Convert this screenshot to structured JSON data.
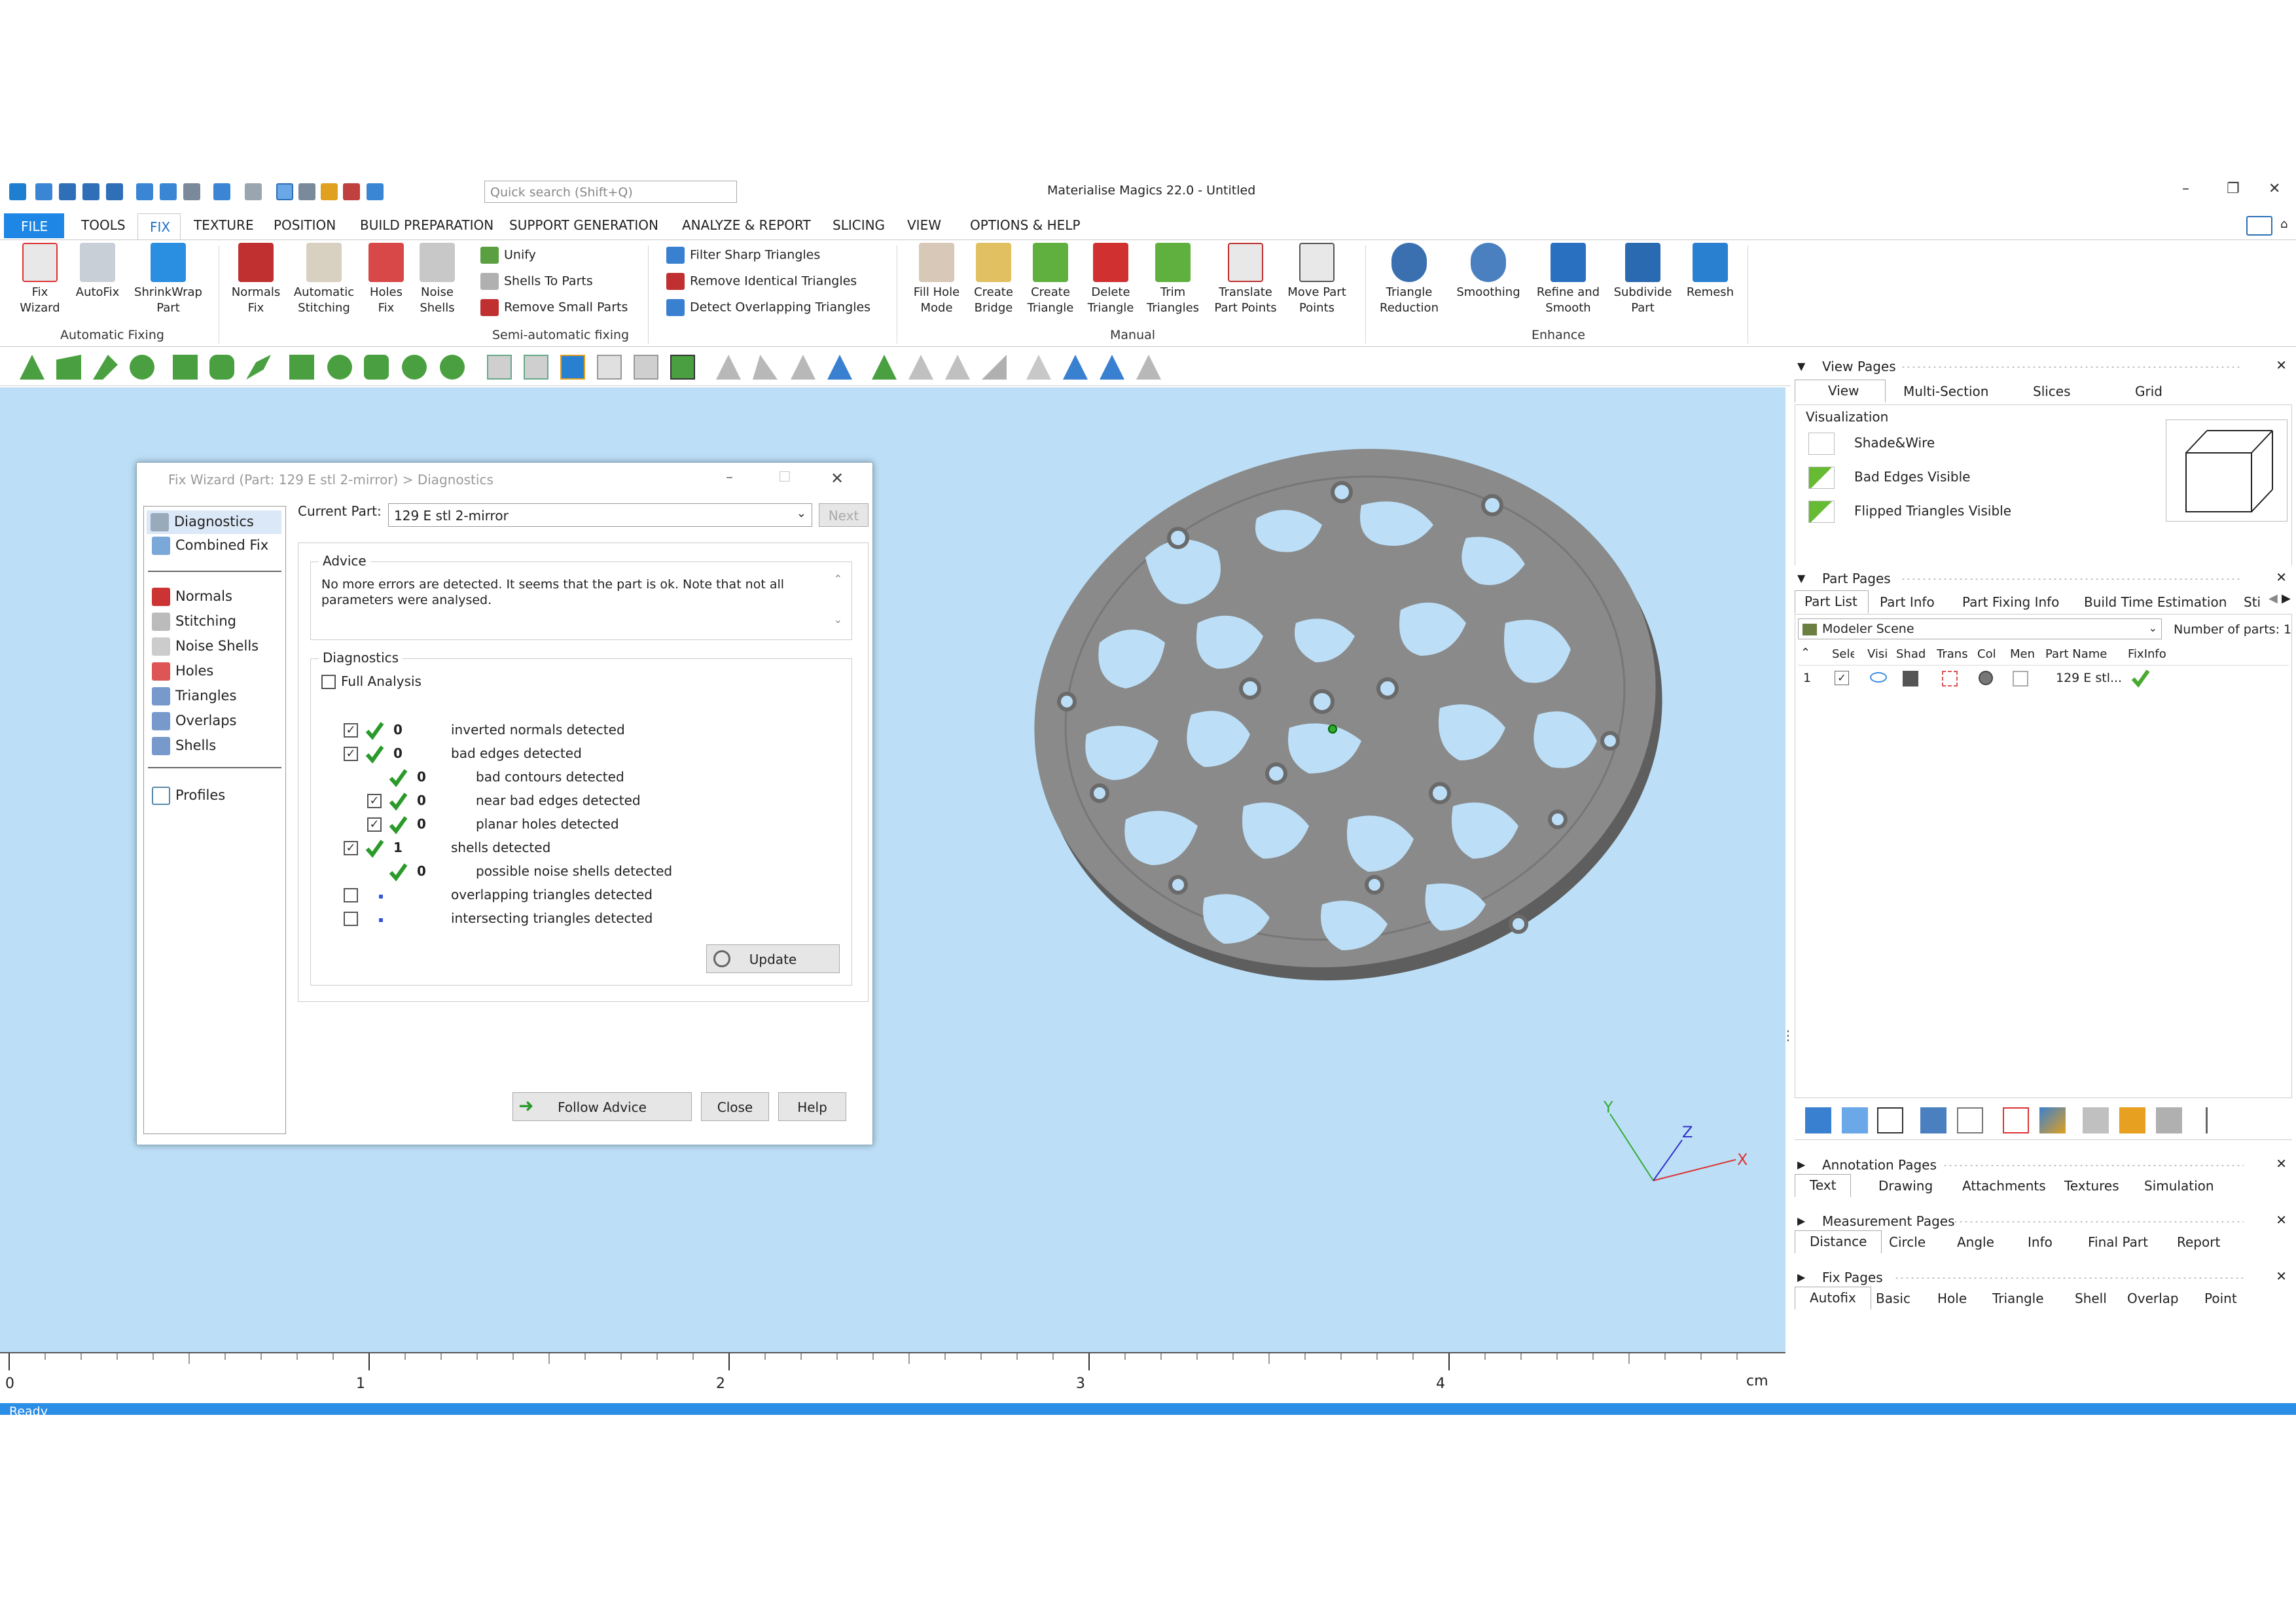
{
  "window": {
    "title": "Materialise Magics 22.0 - Untitled",
    "search_placeholder": "Quick search (Shift+Q)"
  },
  "tabs": [
    "FILE",
    "TOOLS",
    "FIX",
    "TEXTURE",
    "POSITION",
    "BUILD PREPARATION",
    "SUPPORT GENERATION",
    "ANALYZE & REPORT",
    "SLICING",
    "VIEW",
    "OPTIONS & HELP"
  ],
  "ribbon": {
    "auto": [
      {
        "l1": "Fix",
        "l2": "Wizard"
      },
      {
        "l1": "AutoFix",
        "l2": ""
      },
      {
        "l1": "ShrinkWrap",
        "l2": "Part"
      }
    ],
    "auto_group": "Automatic Fixing",
    "semi": [
      {
        "l1": "Normals",
        "l2": "Fix"
      },
      {
        "l1": "Automatic",
        "l2": "Stitching"
      },
      {
        "l1": "Holes",
        "l2": "Fix"
      },
      {
        "l1": "Noise",
        "l2": "Shells"
      }
    ],
    "semi_small": [
      "Unify",
      "Shells To Parts",
      "Remove Small Parts"
    ],
    "semi_group": "Semi-automatic fixing",
    "triangle_small": [
      "Filter Sharp Triangles",
      "Remove Identical Triangles",
      "Detect Overlapping Triangles"
    ],
    "manual": [
      {
        "l1": "Fill Hole",
        "l2": "Mode"
      },
      {
        "l1": "Create",
        "l2": "Bridge"
      },
      {
        "l1": "Create",
        "l2": "Triangle"
      },
      {
        "l1": "Delete",
        "l2": "Triangle"
      },
      {
        "l1": "Trim",
        "l2": "Triangles"
      },
      {
        "l1": "Translate",
        "l2": "Part Points"
      },
      {
        "l1": "Move Part",
        "l2": "Points"
      }
    ],
    "manual_group": "Manual",
    "enhance": [
      {
        "l1": "Triangle",
        "l2": "Reduction"
      },
      {
        "l1": "Smoothing",
        "l2": ""
      },
      {
        "l1": "Refine and",
        "l2": "Smooth"
      },
      {
        "l1": "Subdivide",
        "l2": "Part"
      },
      {
        "l1": "Remesh",
        "l2": ""
      }
    ],
    "enhance_group": "Enhance"
  },
  "dialog": {
    "title": "Fix Wizard (Part: 129 E stl 2-mirror) > Diagnostics",
    "nav_top": [
      "Diagnostics",
      "Combined Fix"
    ],
    "nav_mid": [
      "Normals",
      "Stitching",
      "Noise Shells",
      "Holes",
      "Triangles",
      "Overlaps",
      "Shells"
    ],
    "nav_bottom": [
      "Profiles"
    ],
    "current_part_label": "Current Part:",
    "current_part": "129 E stl 2-mirror",
    "next": "Next",
    "advice_label": "Advice",
    "advice_text": "No more errors are detected. It seems that the part is ok. Note that not all parameters were analysed.",
    "diagnostics_label": "Diagnostics",
    "full_analysis": "Full Analysis",
    "rows": [
      {
        "value": "0",
        "text": "inverted normals detected"
      },
      {
        "value": "0",
        "text": "bad edges detected"
      },
      {
        "value": "0",
        "text": "bad contours detected"
      },
      {
        "value": "0",
        "text": "near bad edges detected"
      },
      {
        "value": "0",
        "text": "planar holes detected"
      },
      {
        "value": "1",
        "text": "shells detected"
      },
      {
        "value": "0",
        "text": "possible noise shells detected"
      },
      {
        "value": "",
        "text": "overlapping triangles detected"
      },
      {
        "value": "",
        "text": "intersecting triangles detected"
      }
    ],
    "update": "Update",
    "follow_advice": "Follow Advice",
    "close": "Close",
    "help": "Help"
  },
  "ruler": {
    "labels": [
      "0",
      "1",
      "2",
      "3",
      "4"
    ],
    "unit": "cm"
  },
  "axes": {
    "x": "X",
    "y": "Y",
    "z": "Z"
  },
  "status": "Ready",
  "view_pages": {
    "title": "View Pages",
    "tabs": [
      "View",
      "Multi-Section",
      "Slices",
      "Grid"
    ],
    "visualization": "Visualization",
    "items": [
      "Shade&Wire",
      "Bad Edges Visible",
      "Flipped Triangles Visible"
    ]
  },
  "part_pages": {
    "title": "Part Pages",
    "tabs": [
      "Part List",
      "Part Info",
      "Part Fixing Info",
      "Build Time Estimation",
      "Sti"
    ],
    "scene": "Modeler Scene",
    "num_parts_label": "Number of parts:",
    "num_parts": "1",
    "columns": [
      "Sele",
      "Visi",
      "Shad",
      "Trans",
      "Col",
      "Men",
      "Part Name",
      "FixInfo"
    ],
    "row_index": "1",
    "part_name": "129 E stl..."
  },
  "annotation_pages": {
    "title": "Annotation Pages",
    "tabs": [
      "Text",
      "Drawing",
      "Attachments",
      "Textures",
      "Simulation"
    ]
  },
  "measurement_pages": {
    "title": "Measurement Pages",
    "tabs": [
      "Distance",
      "Circle",
      "Angle",
      "Info",
      "Final Part",
      "Report"
    ]
  },
  "fix_pages": {
    "title": "Fix Pages",
    "tabs": [
      "Autofix",
      "Basic",
      "Hole",
      "Triangle",
      "Shell",
      "Overlap",
      "Point"
    ]
  },
  "colors": {
    "accent": "#1e87e5",
    "viewport": "#bcdff7",
    "part": "#8c8c8c",
    "check": "#2a9a2a"
  }
}
